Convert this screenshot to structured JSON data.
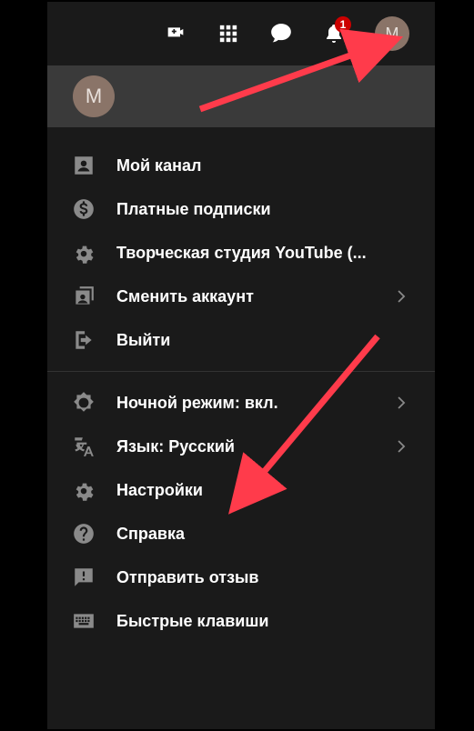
{
  "topbar": {
    "notification_count": "1",
    "avatar_initial": "M"
  },
  "profile": {
    "avatar_initial": "M"
  },
  "menu": {
    "section1": [
      {
        "label": "Мой канал"
      },
      {
        "label": "Платные подписки"
      },
      {
        "label": "Творческая студия YouTube (..."
      },
      {
        "label": "Сменить аккаунт",
        "chevron": true
      },
      {
        "label": "Выйти"
      }
    ],
    "section2": [
      {
        "label": "Ночной режим: вкл.",
        "chevron": true
      },
      {
        "label": "Язык: Русский",
        "chevron": true
      },
      {
        "label": "Настройки"
      },
      {
        "label": "Справка"
      },
      {
        "label": "Отправить отзыв"
      },
      {
        "label": "Быстрые клавиши"
      }
    ]
  },
  "colors": {
    "badge_bg": "#c00",
    "avatar_bg": "#8a7468",
    "arrow": "#ff3b4b"
  }
}
